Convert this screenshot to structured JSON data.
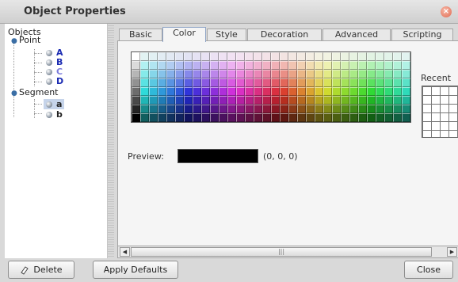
{
  "window": {
    "title": "Object Properties"
  },
  "tree": {
    "root": "Objects",
    "groups": [
      {
        "label": "Point",
        "items": [
          "A",
          "B",
          "C",
          "D"
        ]
      },
      {
        "label": "Segment",
        "items": [
          "a",
          "b"
        ]
      }
    ],
    "selected_item": "a"
  },
  "tabs": [
    "Basic",
    "Color",
    "Style",
    "Decoration",
    "Advanced",
    "Scripting"
  ],
  "active_tab": "Color",
  "color_tab": {
    "recent_label": "Recent",
    "preview_label": "Preview:",
    "preview_color": "#000000",
    "preview_value": "(0, 0, 0)"
  },
  "buttons": {
    "delete": "Delete",
    "apply_defaults": "Apply Defaults",
    "close": "Close"
  },
  "colors": {
    "point_label": "#1c2cb3",
    "point_label_light": "#7b7bdc",
    "segment_label": "#222222",
    "selection": "#c6d4ea"
  }
}
